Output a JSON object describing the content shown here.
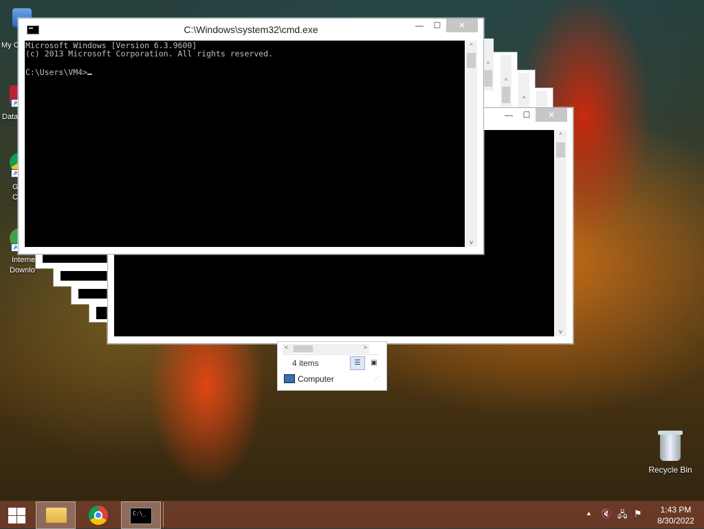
{
  "desktop": {
    "icons": [
      {
        "label": "My C"
      },
      {
        "label": "Data"
      },
      {
        "label": "G"
      },
      {
        "label": "C"
      },
      {
        "label": "Interne"
      },
      {
        "label": "Downlo"
      }
    ],
    "recycle_bin": "Recycle Bin"
  },
  "cmd": {
    "title": "C:\\Windows\\system32\\cmd.exe",
    "minimize": "—",
    "maximize": "☐",
    "close": "✕",
    "lines": [
      "Microsoft Windows [Version 6.3.9600]",
      "(c) 2013 Microsoft Corporation. All rights reserved.",
      "",
      "C:\\Users\\VM4>"
    ]
  },
  "explorer": {
    "status": "4 items",
    "nav_item": "Computer"
  },
  "taskbar": {
    "time": "1:43 PM",
    "date": "8/30/2022"
  },
  "colors": {
    "console_bg": "#000000",
    "console_text": "#c0c0c0",
    "taskbar": "#6e3c28"
  }
}
